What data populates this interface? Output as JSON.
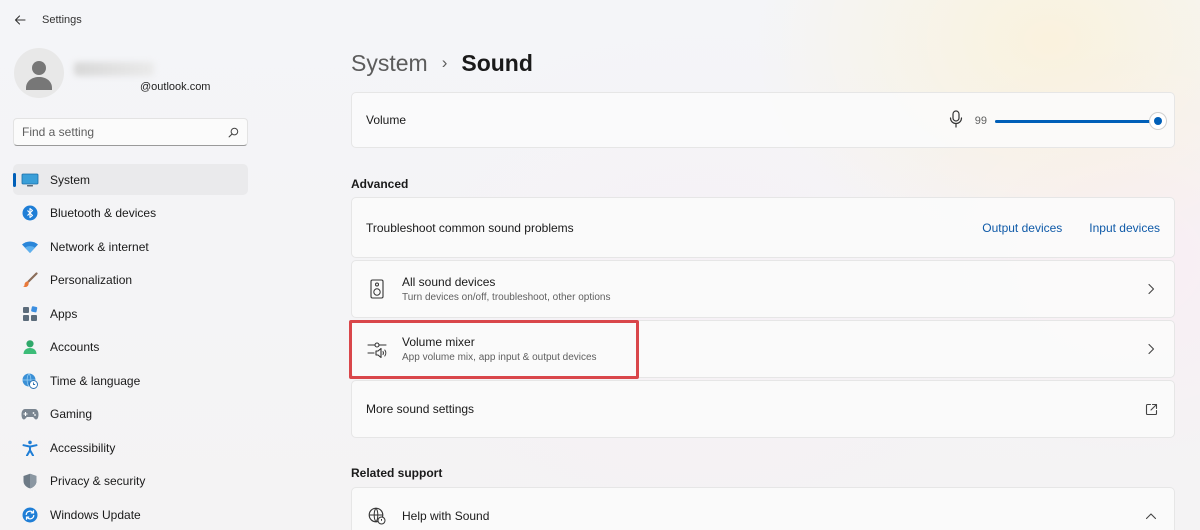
{
  "window": {
    "title": "Settings"
  },
  "profile": {
    "email": "@outlook.com"
  },
  "search": {
    "placeholder": "Find a setting"
  },
  "sidebar": {
    "items": [
      {
        "label": "System",
        "icon": "monitor-icon",
        "active": true
      },
      {
        "label": "Bluetooth & devices",
        "icon": "bluetooth-icon"
      },
      {
        "label": "Network & internet",
        "icon": "wifi-icon"
      },
      {
        "label": "Personalization",
        "icon": "brush-icon"
      },
      {
        "label": "Apps",
        "icon": "apps-icon"
      },
      {
        "label": "Accounts",
        "icon": "person-icon"
      },
      {
        "label": "Time & language",
        "icon": "globe-clock-icon"
      },
      {
        "label": "Gaming",
        "icon": "gamepad-icon"
      },
      {
        "label": "Accessibility",
        "icon": "accessibility-icon"
      },
      {
        "label": "Privacy & security",
        "icon": "shield-icon"
      },
      {
        "label": "Windows Update",
        "icon": "update-icon"
      }
    ]
  },
  "breadcrumb": {
    "parent": "System",
    "separator": "›",
    "current": "Sound"
  },
  "volume": {
    "label": "Volume",
    "value": "99",
    "level_percent": 99,
    "icon": "microphone-icon"
  },
  "advanced": {
    "heading": "Advanced",
    "troubleshoot": {
      "label": "Troubleshoot common sound problems",
      "output_link": "Output devices",
      "input_link": "Input devices"
    },
    "all_devices": {
      "title": "All sound devices",
      "subtitle": "Turn devices on/off, troubleshoot, other options",
      "icon": "speaker-icon"
    },
    "mixer": {
      "title": "Volume mixer",
      "subtitle": "App volume mix, app input & output devices",
      "icon": "mixer-icon",
      "highlighted": true
    },
    "more": {
      "title": "More sound settings",
      "icon": "external-link-icon"
    }
  },
  "related": {
    "heading": "Related support",
    "help": {
      "title": "Help with Sound",
      "icon": "globe-icon"
    }
  },
  "colors": {
    "accent": "#005fb8",
    "link": "#0f5aa8",
    "highlight": "#d9464a"
  }
}
